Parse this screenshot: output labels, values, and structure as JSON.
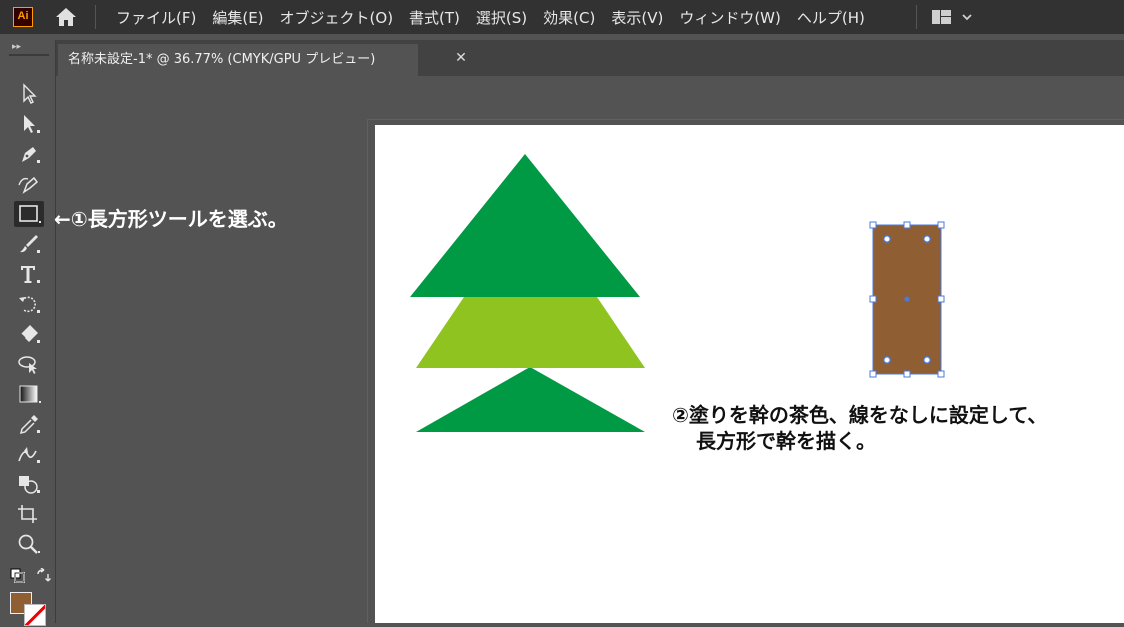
{
  "app": {
    "logo_text": "Ai"
  },
  "menu": {
    "items": [
      {
        "label": "ファイル(F)"
      },
      {
        "label": "編集(E)"
      },
      {
        "label": "オブジェクト(O)"
      },
      {
        "label": "書式(T)"
      },
      {
        "label": "選択(S)"
      },
      {
        "label": "効果(C)"
      },
      {
        "label": "表示(V)"
      },
      {
        "label": "ウィンドウ(W)"
      },
      {
        "label": "ヘルプ(H)"
      }
    ]
  },
  "document_tab": {
    "title": "名称未設定-1* @ 36.77% (CMYK/GPU プレビュー)",
    "close_glyph": "✕"
  },
  "tools": [
    {
      "icon": "selection-tool-icon"
    },
    {
      "icon": "direct-selection-tool-icon"
    },
    {
      "icon": "pen-tool-icon"
    },
    {
      "icon": "curvature-tool-icon"
    },
    {
      "icon": "rectangle-tool-icon",
      "active": true
    },
    {
      "icon": "paintbrush-tool-icon"
    },
    {
      "icon": "type-tool-icon"
    },
    {
      "icon": "rotate-tool-icon"
    },
    {
      "icon": "eraser-tool-icon"
    },
    {
      "icon": "lasso-tool-icon"
    },
    {
      "icon": "gradient-tool-icon"
    },
    {
      "icon": "eyedropper-tool-icon"
    },
    {
      "icon": "puppet-warp-tool-icon"
    },
    {
      "icon": "shape-builder-tool-icon"
    },
    {
      "icon": "artboard-tool-icon"
    },
    {
      "icon": "zoom-tool-icon"
    }
  ],
  "annotations": {
    "step1": "←①長方形ツールを選ぶ。",
    "step2_line1": "②塗りを幹の茶色、線をなしに設定して、",
    "step2_line2": "長方形で幹を描く。"
  },
  "colors": {
    "tree_dark_green": "#009944",
    "tree_light_green": "#8fc31f",
    "trunk_brown": "#8f5e33",
    "fill_swatch": "#8f5e33",
    "stroke_swatch": "none",
    "selection_blue": "#4a7bdc"
  }
}
